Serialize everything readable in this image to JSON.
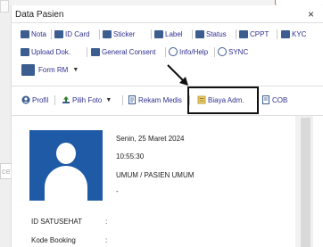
{
  "background": {
    "partial_text": "cer"
  },
  "panel": {
    "title": "Data Pasien",
    "close_glyph": "×"
  },
  "toolbar_row1": [
    {
      "label": "Nota",
      "icon": "printer-icon"
    },
    {
      "label": "ID Card",
      "icon": "printer-icon"
    },
    {
      "label": "Sticker",
      "icon": "printer-icon"
    },
    {
      "label": "Label",
      "icon": "printer-icon"
    },
    {
      "label": "Status",
      "icon": "printer-icon"
    },
    {
      "label": "CPPT",
      "icon": "printer-icon"
    },
    {
      "label": "KYC",
      "icon": "printer-icon"
    }
  ],
  "toolbar_row2": [
    {
      "label": "Upload Dok.",
      "icon": "upload-icon"
    },
    {
      "label": "General Consent",
      "icon": "printer-icon"
    },
    {
      "label": "Info/Help",
      "icon": "info-icon"
    },
    {
      "label": "SYNC",
      "icon": "sync-icon"
    }
  ],
  "form_rm": {
    "label": "Form RM",
    "caret": "▼"
  },
  "tabs": [
    {
      "label": "Profil",
      "icon": "profile-icon"
    },
    {
      "label": "Pilih Foto",
      "icon": "upload-icon",
      "caret": "▼"
    },
    {
      "label": "Rekam Medis",
      "icon": "document-icon"
    },
    {
      "label": "Biaya Adm.",
      "icon": "receipt-icon"
    },
    {
      "label": "COB",
      "icon": "document-icon"
    }
  ],
  "patient": {
    "date": "Senin, 25 Maret 2024",
    "time": "10:55:30",
    "category": "UMUM / PASIEN UMUM",
    "extra": "-"
  },
  "fields": [
    {
      "label": "ID SATUSEHAT",
      "colon": ":"
    },
    {
      "label": "Kode Booking",
      "colon": ":"
    }
  ],
  "colors": {
    "link": "#2f2f8f",
    "icon": "#3b5d8f",
    "avatar_bg": "#1f5aa6",
    "highlight_border": "#111111"
  }
}
